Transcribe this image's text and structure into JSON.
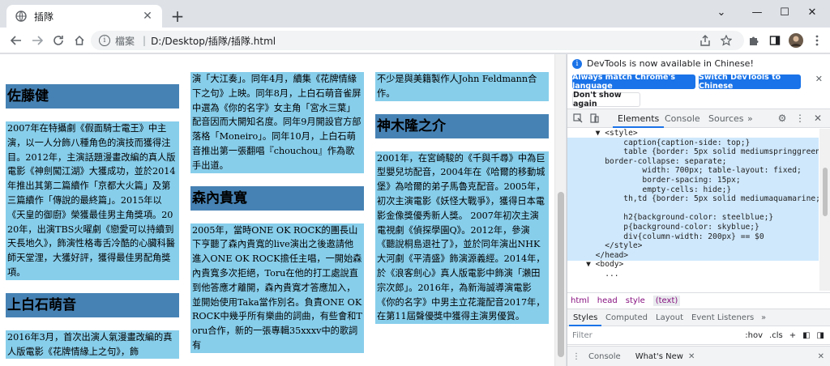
{
  "browser": {
    "tab_title": "插隊",
    "tab_close": "✕",
    "new_tab": "+",
    "address_label": "檔案",
    "address_url": "D:/Desktop/插隊/插隊.html",
    "window_minimize": "—",
    "window_maximize": "☐",
    "window_close": "✕",
    "chevron": "⌄"
  },
  "columns": [
    {
      "blocks": [
        {
          "type": "h2",
          "text": "佐藤健"
        },
        {
          "type": "p",
          "text": "2007年在特攝劇《假面騎士電王》中主演，以一人分飾八種角色的演技而獲得注目。2012年，主演話題漫畫改編的真人版電影《神劍闖江湖》大獲成功，並於2014年推出其第二篇續作「京都大火篇」及第三篇續作「傳說的最終篇」。2015年以《天皇的御廚》榮獲最佳男主角獎項。2020年，出演TBS火曜劇《戀愛可以持續到天長地久》，飾演性格毒舌冷酷的心臟科醫師天堂浬，大獲好評，獲得最佳男配角獎項。"
        },
        {
          "type": "h2",
          "text": "上白石萌音"
        },
        {
          "type": "p",
          "text": "2016年3月，首次出演人氣漫畫改編的真人版電影《花牌情緣上之句》，飾"
        }
      ]
    },
    {
      "blocks": [
        {
          "type": "p",
          "text": "演「大江奏」。同年4月，續集《花牌情緣下之句》上映。同年8月，上白石萌音雀屏中選為《你的名字》女主角「宮水三葉」配音因而大開知名度。同年9月開設官方部落格「Moneiro」。同年10月，上白石萌音推出第一張翻唱『chouchou』作為歌手出道。"
        },
        {
          "type": "h2",
          "text": "森內貴寬"
        },
        {
          "type": "p",
          "text": "2005年，當時ONE OK ROCK的團長山下亨聽了森內貴寬的live演出之後邀請他進入ONE OK ROCK擔任主唱，一開始森內貴寬多次拒絕，Toru在他的打工處說直到他答應才離開，森內貴寬才答應加入，並開始使用Taka當作別名。負責ONE OK ROCK中幾乎所有樂曲的詞曲，有些會和Toru合作，新的一張專輯35xxxv中的歌詞有"
        }
      ]
    },
    {
      "blocks": [
        {
          "type": "p",
          "text": "不少是與美籍製作人John Feldmann合作。"
        },
        {
          "type": "h2",
          "text": "神木隆之介"
        },
        {
          "type": "p",
          "text": "2001年，在宮崎駿的《千與千尋》中為巨型嬰兒坊配音，2004年在《哈爾的移動城堡》為哈爾的弟子馬魯克配音。2005年，初次主演電影《妖怪大戰爭》，獲得日本電影金像獎優秀新人獎。 2007年初次主演電視劇《偵探學園Q》。2012年，參演《聽說桐島退社了》，並於同年演出NHK大河劇《平清盛》飾演源義經。2014年，於《浪客劍心》真人版電影中飾演「瀨田宗次郎」。2016年，為新海誠導演電影《你的名字》中男主立花瀧配音2017年，在第11屆聲優獎中獲得主演男優賞。"
        }
      ]
    }
  ],
  "devtools": {
    "banner_text": "DevTools is now available in Chinese!",
    "btn_match": "Always match Chrome's language",
    "btn_switch": "Switch DevTools to Chinese",
    "btn_dont_show": "Don't show again",
    "banner_close": "✕",
    "tabs": [
      "Elements",
      "Console",
      "Sources",
      "»"
    ],
    "code_lines": [
      "      ▼ <style>",
      "            caption{caption-side: top;}",
      "            table {border: 5px solid mediumspringgreen;",
      "        border-collapse: separate;",
      "                width: 700px; table-layout: fixed;",
      "                border-spacing: 15px;",
      "                empty-cells: hide;}",
      "            th,td {border: 5px solid mediumaquamarine;}",
      "",
      "            h2{background-color: steelblue;}",
      "            p{background-color: skyblue;}",
      "            div{column-width: 200px} == $0",
      "        </style>",
      "      </head>",
      "    ▼ <body>",
      "        ..."
    ],
    "breadcrumbs": [
      "html",
      "head",
      "style",
      "(text)"
    ],
    "subtabs": [
      "Styles",
      "Computed",
      "Layout",
      "Event Listeners",
      "»"
    ],
    "filter_placeholder": "Filter",
    "filter_hov": ":hov",
    "filter_cls": ".cls",
    "drawer_console": "Console",
    "drawer_whatsnew": "What's New",
    "drawer_close": "✕"
  },
  "colors": {
    "h2_bg": "#4682b4",
    "p_bg": "#87ceeb",
    "accent": "#1a73e8"
  }
}
